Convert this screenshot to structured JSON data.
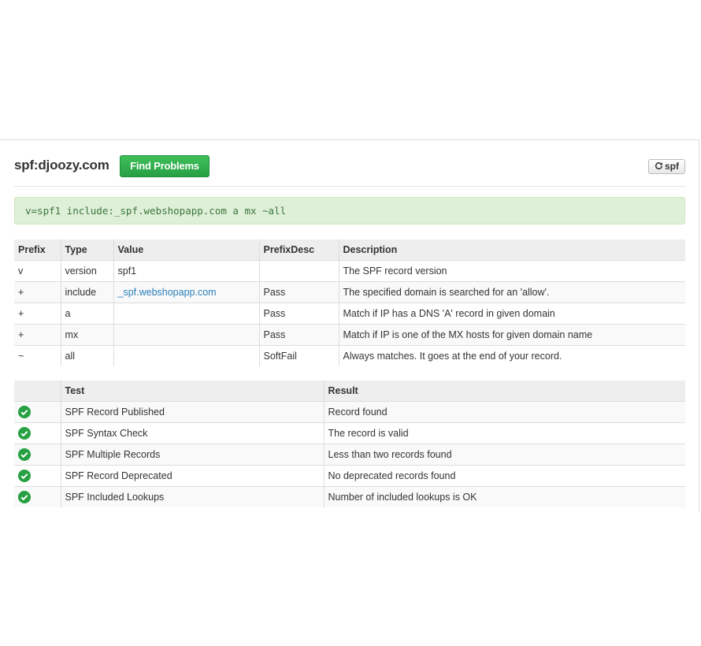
{
  "header": {
    "title": "spf:djoozy.com",
    "find_problems_label": "Find Problems",
    "refresh_label": "spf"
  },
  "record": "v=spf1 include:_spf.webshopapp.com a mx ~all",
  "spf_table": {
    "headers": [
      "Prefix",
      "Type",
      "Value",
      "PrefixDesc",
      "Description"
    ],
    "rows": [
      [
        "v",
        "version",
        "spf1",
        "",
        "The SPF record version"
      ],
      [
        "+",
        "include",
        "_spf.webshopapp.com",
        "Pass",
        "The specified domain is searched for an 'allow'."
      ],
      [
        "+",
        "a",
        "",
        "Pass",
        "Match if IP has a DNS 'A' record in given domain"
      ],
      [
        "+",
        "mx",
        "",
        "Pass",
        "Match if IP is one of the MX hosts for given domain name"
      ],
      [
        "~",
        "all",
        "",
        "SoftFail",
        "Always matches. It goes at the end of your record."
      ]
    ]
  },
  "test_table": {
    "headers": [
      "",
      "Test",
      "Result"
    ],
    "rows": [
      {
        "status_icon": "check-circle-icon",
        "test": "SPF Record Published",
        "result": "Record found"
      },
      {
        "status_icon": "check-circle-icon",
        "test": "SPF Syntax Check",
        "result": "The record is valid"
      },
      {
        "status_icon": "check-circle-icon",
        "test": "SPF Multiple Records",
        "result": "Less than two records found"
      },
      {
        "status_icon": "check-circle-icon",
        "test": "SPF Record Deprecated",
        "result": "No deprecated records found"
      },
      {
        "status_icon": "check-circle-icon",
        "test": "SPF Included Lookups",
        "result": "Number of included lookups is OK"
      }
    ]
  },
  "colors": {
    "success_green": "#27a043",
    "record_bg": "#dff0d8",
    "record_text": "#3c763d",
    "link_blue": "#2a7fb8"
  }
}
